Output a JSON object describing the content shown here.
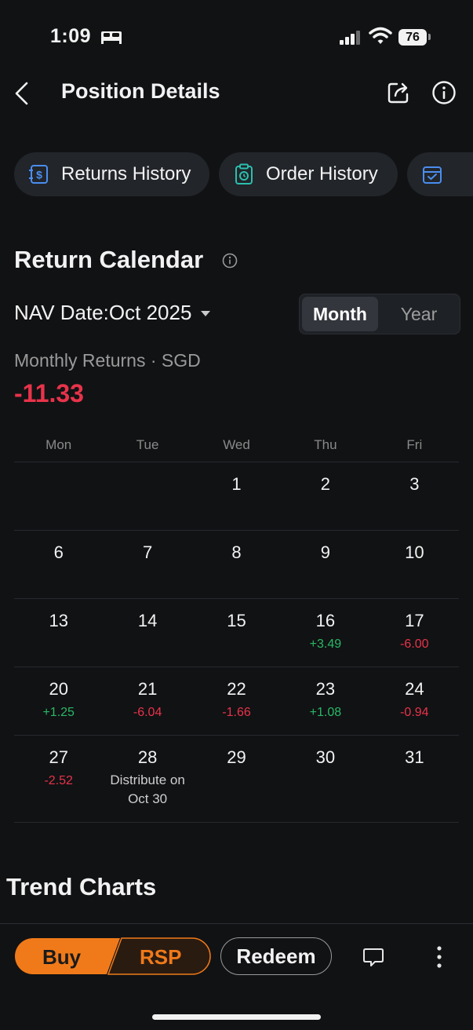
{
  "status_bar": {
    "time": "1:09",
    "battery": "76"
  },
  "header": {
    "title": "Position Details"
  },
  "chips": [
    {
      "label": "Returns History",
      "icon": "dollar-document-icon"
    },
    {
      "label": "Order History",
      "icon": "clock-clipboard-icon"
    },
    {
      "label": "",
      "icon": "calendar-check-icon"
    }
  ],
  "return_calendar": {
    "title": "Return Calendar",
    "nav_date": "NAV Date:Oct 2025",
    "toggle": {
      "month": "Month",
      "year": "Year",
      "selected": "Month"
    },
    "monthly_label": "Monthly Returns · SGD",
    "monthly_value": "-11.33",
    "weekdays": [
      "Mon",
      "Tue",
      "Wed",
      "Thu",
      "Fri"
    ],
    "weeks": [
      [
        {
          "day": "",
          "ret": ""
        },
        {
          "day": "",
          "ret": ""
        },
        {
          "day": "1",
          "ret": ""
        },
        {
          "day": "2",
          "ret": ""
        },
        {
          "day": "3",
          "ret": ""
        }
      ],
      [
        {
          "day": "6",
          "ret": ""
        },
        {
          "day": "7",
          "ret": ""
        },
        {
          "day": "8",
          "ret": ""
        },
        {
          "day": "9",
          "ret": ""
        },
        {
          "day": "10",
          "ret": ""
        }
      ],
      [
        {
          "day": "13",
          "ret": ""
        },
        {
          "day": "14",
          "ret": ""
        },
        {
          "day": "15",
          "ret": ""
        },
        {
          "day": "16",
          "ret": "+3.49"
        },
        {
          "day": "17",
          "ret": "-6.00"
        }
      ],
      [
        {
          "day": "20",
          "ret": "+1.25"
        },
        {
          "day": "21",
          "ret": "-6.04"
        },
        {
          "day": "22",
          "ret": "-1.66"
        },
        {
          "day": "23",
          "ret": "+1.08"
        },
        {
          "day": "24",
          "ret": "-0.94"
        }
      ],
      [
        {
          "day": "27",
          "ret": "-2.52"
        },
        {
          "day": "28",
          "ret": "Distribute on Oct 30"
        },
        {
          "day": "29",
          "ret": ""
        },
        {
          "day": "30",
          "ret": ""
        },
        {
          "day": "31",
          "ret": ""
        }
      ]
    ]
  },
  "trend_charts": {
    "title": "Trend Charts"
  },
  "bottom_bar": {
    "buy": "Buy",
    "rsp": "RSP",
    "redeem": "Redeem"
  },
  "colors": {
    "accent": "#f07a1a",
    "positive": "#29b866",
    "negative": "#e8334a",
    "background": "#111214"
  }
}
